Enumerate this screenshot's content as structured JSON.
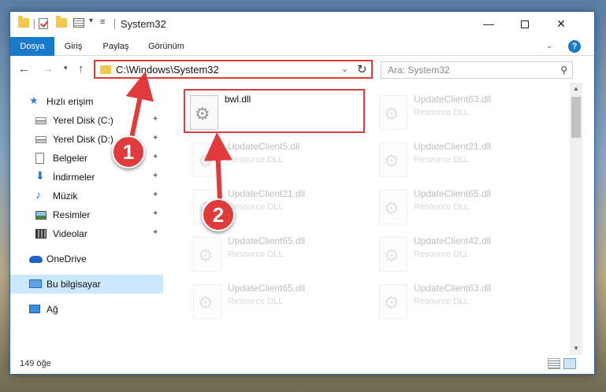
{
  "window": {
    "title": "System32",
    "minimize_glyph": "—",
    "close_glyph": "✕"
  },
  "ribbon": {
    "tabs": [
      "Dosya",
      "Giriş",
      "Paylaş",
      "Görünüm"
    ],
    "help_glyph": "?"
  },
  "navigation": {
    "back_glyph": "←",
    "forward_glyph": "→",
    "recent_glyph": "▾",
    "up_glyph": "↑",
    "address_path": "C:\\Windows\\System32",
    "refresh_glyph": "↻",
    "search_placeholder": "Ara: System32"
  },
  "sidebar": {
    "items": [
      {
        "label": "Hızlı erişim"
      },
      {
        "label": "Yerel Disk (C:)"
      },
      {
        "label": "Yerel Disk (D:)"
      },
      {
        "label": "Belgeler"
      },
      {
        "label": "İndirmeler"
      },
      {
        "label": "Müzik"
      },
      {
        "label": "Resimler"
      },
      {
        "label": "Videolar"
      },
      {
        "label": "OneDrive"
      },
      {
        "label": "Bu bilgisayar"
      },
      {
        "label": "Ağ"
      }
    ],
    "pin_glyph": "📌"
  },
  "files": {
    "items": [
      {
        "name": "bwl.dll",
        "type": ""
      },
      {
        "name": "UpdateClient63.dll",
        "type": "Resource DLL"
      },
      {
        "name": "UpdateClient5.dll",
        "type": "Resource DLL"
      },
      {
        "name": "UpdateClient21.dll",
        "type": "Resource DLL"
      },
      {
        "name": "UpdateClient21.dll",
        "type": "Resource DLL"
      },
      {
        "name": "UpdateClient65.dll",
        "type": "Resource DLL"
      },
      {
        "name": "UpdateClient65.dll",
        "type": "Resource DLL"
      },
      {
        "name": "UpdateClient42.dll",
        "type": "Resource DLL"
      },
      {
        "name": "UpdateClient65.dll",
        "type": "Resource DLL"
      },
      {
        "name": "UpdateClient63.dll",
        "type": "Resource DLL"
      }
    ]
  },
  "status": {
    "item_count": "149 öğe"
  },
  "annotations": {
    "badge_1": "1",
    "badge_2": "2",
    "accent_color": "#e03a3a"
  }
}
